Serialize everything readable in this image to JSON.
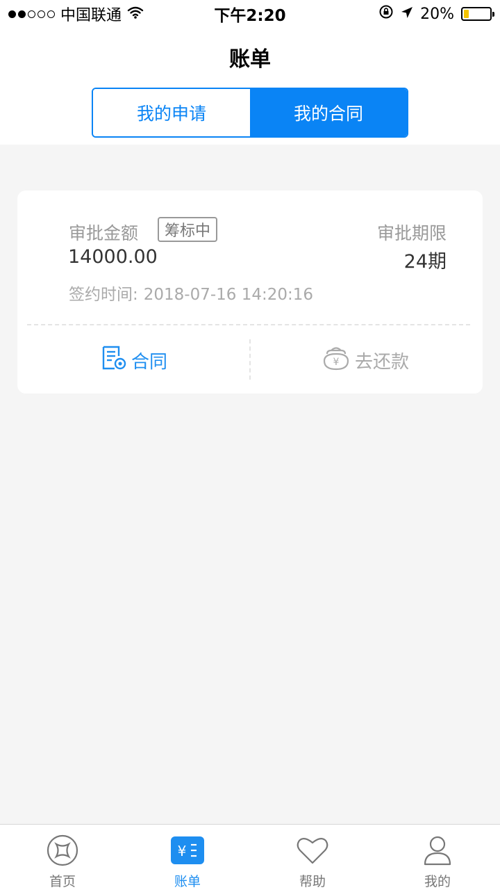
{
  "status_bar": {
    "carrier": "中国联通",
    "time": "下午2:20",
    "battery_percent": "20%",
    "battery_level": 0.2
  },
  "header": {
    "title": "账单"
  },
  "segment": {
    "tabs": [
      {
        "label": "我的申请",
        "active": false
      },
      {
        "label": "我的合同",
        "active": true
      }
    ]
  },
  "card": {
    "amount_label": "审批金额",
    "status_badge": "筹标中",
    "amount_value": "14000.00",
    "period_label": "审批期限",
    "period_value": "24期",
    "sign_label": "签约时间:",
    "sign_value": "2018-07-16 14:20:16",
    "action_contract": "合同",
    "action_repay": "去还款"
  },
  "tab_bar": {
    "items": [
      {
        "label": "首页",
        "icon": "home-icon",
        "active": false
      },
      {
        "label": "账单",
        "icon": "bill-icon",
        "active": true
      },
      {
        "label": "帮助",
        "icon": "heart-icon",
        "active": false
      },
      {
        "label": "我的",
        "icon": "user-icon",
        "active": false
      }
    ]
  },
  "colors": {
    "accent": "#0a84f5",
    "background": "#f5f5f5",
    "muted_text": "#999999"
  }
}
